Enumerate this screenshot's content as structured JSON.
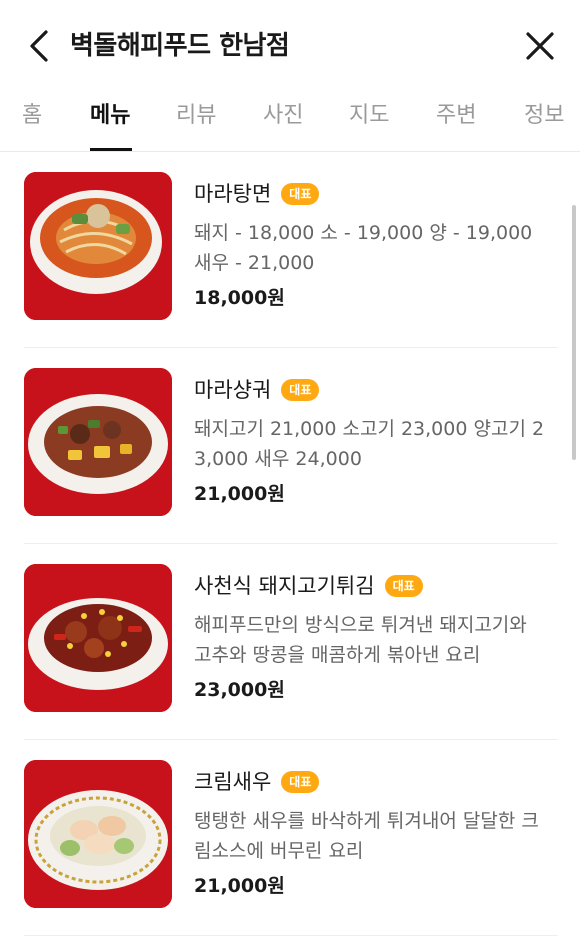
{
  "header": {
    "title": "벽돌해피푸드 한남점",
    "back_icon": "chevron-left-icon",
    "close_icon": "close-icon"
  },
  "tabs": [
    {
      "label": "홈",
      "active": false
    },
    {
      "label": "메뉴",
      "active": true
    },
    {
      "label": "리뷰",
      "active": false
    },
    {
      "label": "사진",
      "active": false
    },
    {
      "label": "지도",
      "active": false
    },
    {
      "label": "주변",
      "active": false
    },
    {
      "label": "정보",
      "active": false
    }
  ],
  "menu": {
    "items": [
      {
        "name": "마라탕면",
        "badge": "대표",
        "description": "돼지 - 18,000 소 - 19,000 양 - 19,000 새우 - 21,000",
        "price": "18,000원"
      },
      {
        "name": "마라샹궈",
        "badge": "대표",
        "description": "돼지고기 21,000 소고기 23,000 양고기 23,000 새우 24,000",
        "price": "21,000원"
      },
      {
        "name": "사천식 돼지고기튀김",
        "badge": "대표",
        "description": "해피푸드만의 방식으로 튀겨낸 돼지고기와 고추와 땅콩을 매콤하게 볶아낸 요리",
        "price": "23,000원"
      },
      {
        "name": "크림새우",
        "badge": "대표",
        "description": "탱탱한 새우를 바삭하게 튀겨내어 달달한 크림소스에 버무린 요리",
        "price": "21,000원"
      }
    ]
  },
  "colors": {
    "badge": "#ffa912",
    "thumb_background": "#c8121b",
    "active_tab": "#111111",
    "inactive_tab": "#9a9a9a"
  }
}
